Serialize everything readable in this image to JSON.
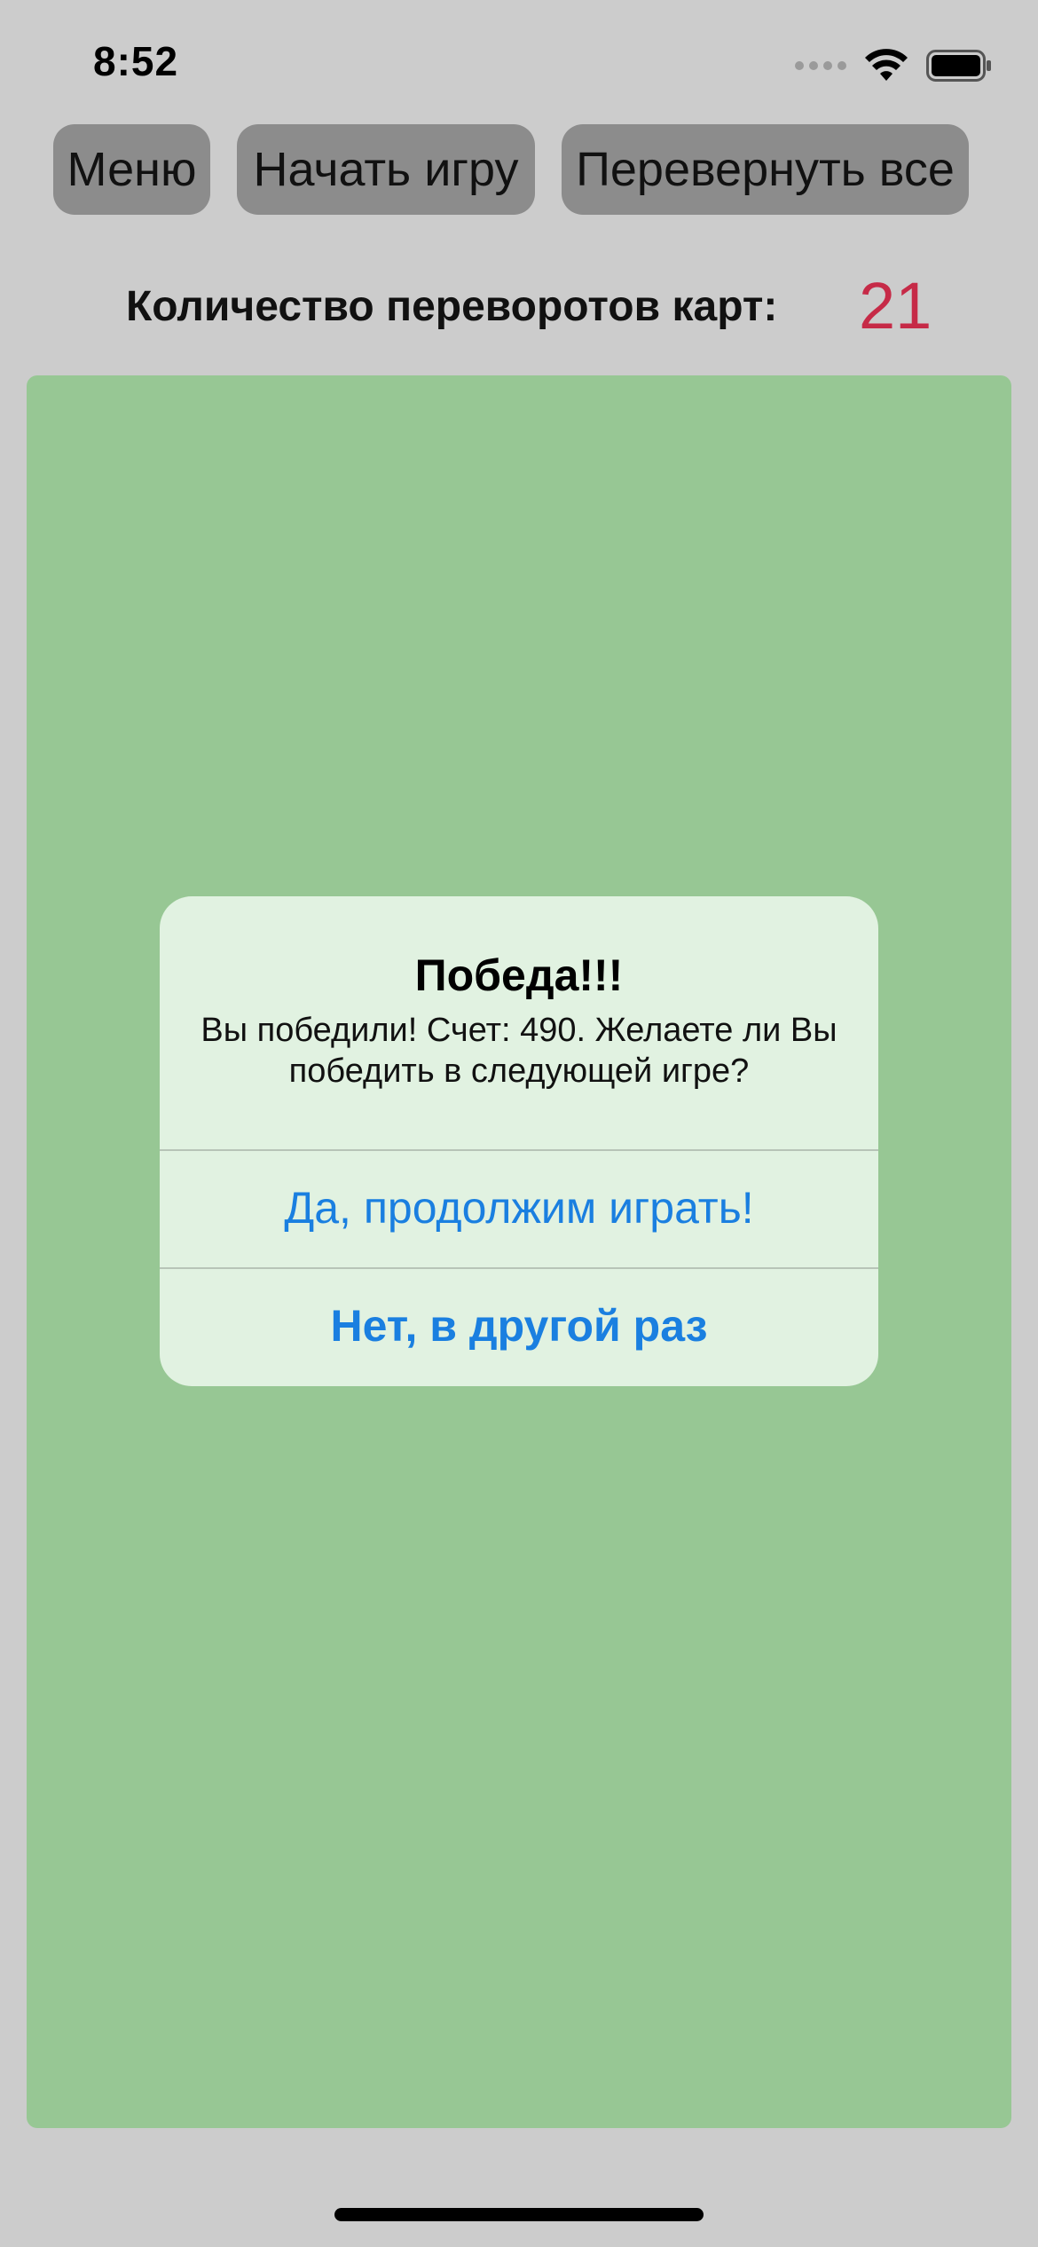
{
  "status_bar": {
    "time": "8:52"
  },
  "toolbar": {
    "menu_label": "Меню",
    "start_label": "Начать игру",
    "flip_all_label": "Перевернуть все"
  },
  "flips": {
    "label": "Количество переворотов карт:",
    "count": "21",
    "count_color": "#c62a47"
  },
  "board": {
    "color": "#97c794"
  },
  "alert": {
    "title": "Победа!!!",
    "message": "Вы победили! Счет: 490. Желаете ли Вы победить в следующей игре?",
    "yes_label": "Да, продолжим играть!",
    "no_label": "Нет, в другой раз",
    "action_color": "#1a7fe0"
  },
  "icons": [
    "wifi-icon",
    "battery-icon",
    "cellular-signal-icon"
  ]
}
